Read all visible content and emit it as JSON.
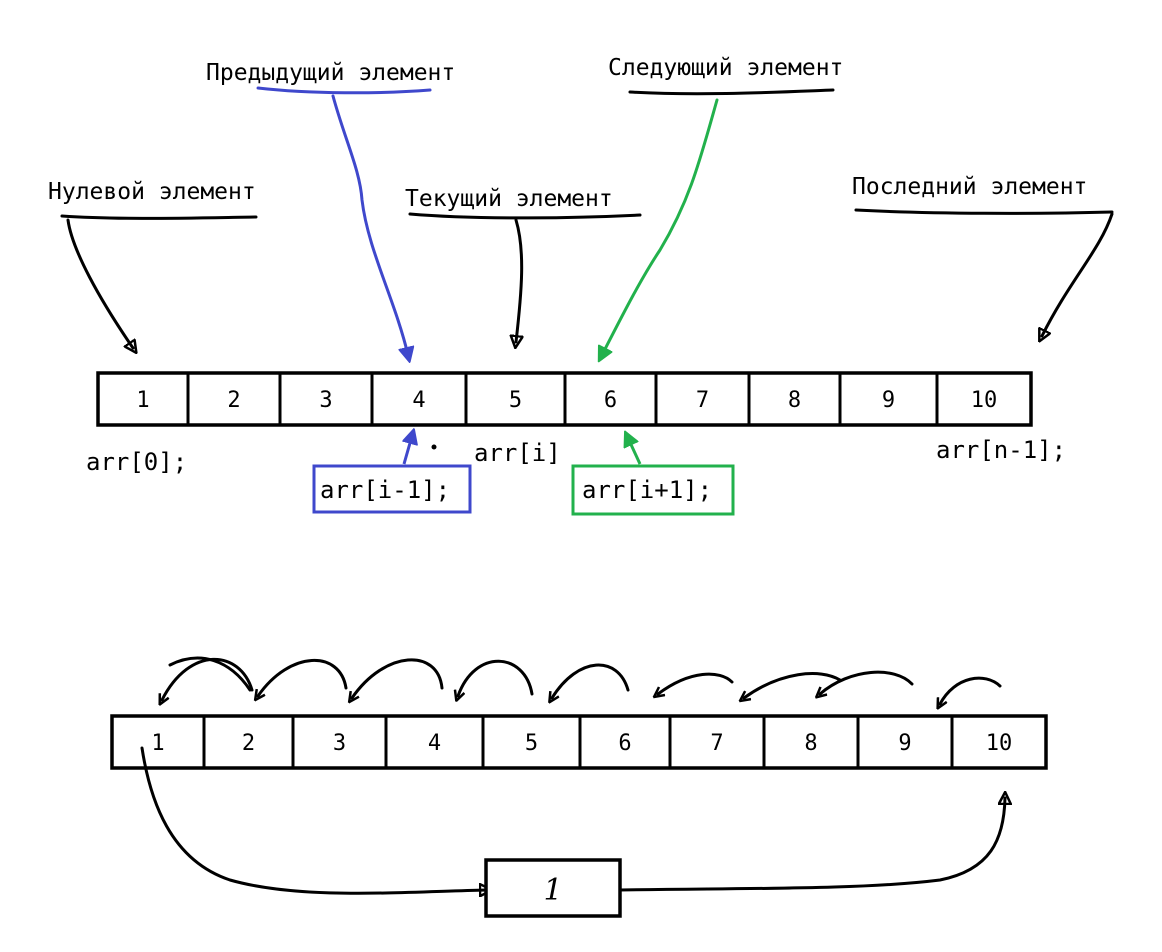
{
  "labels": {
    "zero": "Нулевой элемент",
    "previous": "Предыдущий элемент",
    "current": "Текущий элемент",
    "next": "Следующий элемент",
    "last": "Последний элемент"
  },
  "code": {
    "first": "arr[0];",
    "previous": "arr[i-1];",
    "current": "arr[i]",
    "next": "arr[i+1];",
    "last": "arr[n-1];"
  },
  "top_array": [
    "1",
    "2",
    "3",
    "4",
    "5",
    "6",
    "7",
    "8",
    "9",
    "10"
  ],
  "bottom_array": [
    "1",
    "2",
    "3",
    "4",
    "5",
    "6",
    "7",
    "8",
    "9",
    "10"
  ],
  "temp_value": "1",
  "colors": {
    "ink": "#000000",
    "previous": "#3f48cc",
    "next": "#22b14c"
  }
}
